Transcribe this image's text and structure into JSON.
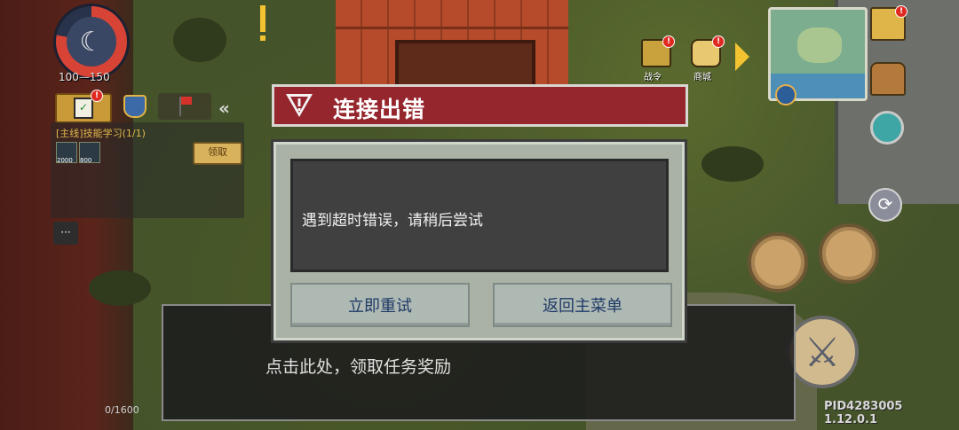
{
  "hud": {
    "hp_current": "100",
    "hp_max": "150",
    "quest_panel": {
      "title": "[主线]技能学习(1/1)",
      "rewards": [
        {
          "amount": "2000"
        },
        {
          "amount": "800"
        }
      ],
      "claim_label": "领取"
    },
    "collapse_label": "«",
    "chat_label": "···",
    "shops": [
      {
        "label": "战令"
      },
      {
        "label": "商城"
      }
    ],
    "xp_text": "0/1600",
    "version_text": "PID4283005 1.12.0.1"
  },
  "dialog": {
    "title": "连接出错",
    "message": "遇到超时错误，请稍后尝试",
    "retry_label": "立即重试",
    "menu_label": "返回主菜单"
  },
  "task_hint": "点击此处，领取任务奖励",
  "colors": {
    "dialog_header": "#96262d",
    "dialog_body": "#a9b2a4",
    "button_text": "#1f3a66"
  }
}
